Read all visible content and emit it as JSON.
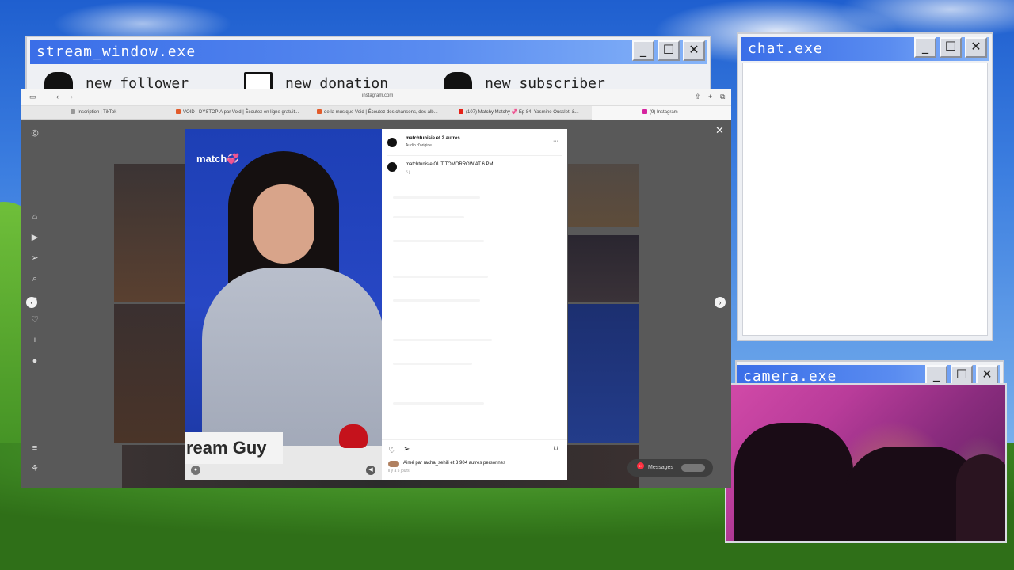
{
  "stream_window": {
    "title": "stream_window.exe",
    "alerts": [
      {
        "label": "new follower"
      },
      {
        "label": "new donation"
      },
      {
        "label": "new subscriber"
      }
    ]
  },
  "chat_window": {
    "title": "chat.exe"
  },
  "camera_window": {
    "title": "camera.exe"
  },
  "window_buttons": {
    "minimize": "_",
    "maximize": "☐",
    "close": "✕"
  },
  "browser": {
    "url": "instagram.com",
    "tabs": [
      {
        "label": "Inscription | TikTok"
      },
      {
        "label": "VOID - DYSTOPIA par Void | Écoutez en ligne gratuit..."
      },
      {
        "label": "de la musique Void | Écoutez des chansons, des alb..."
      },
      {
        "label": "(107) Matchy Matchy 💞 Ep 84: Yasmine Oussleti &..."
      },
      {
        "label": "(9) Instagram"
      }
    ]
  },
  "instagram": {
    "post": {
      "author_line": "matchtunisie et 2 autres",
      "audio": "Audio d'origine",
      "caption_user": "matchtunisie",
      "caption_text": "OUT TOMORROW AT 6 PM",
      "caption_age": "5 j",
      "liked_by": "Aimé par racha_sehili et 3 904 autres personnes",
      "posted_ago": "il y a 5 jours",
      "more_icon": "···"
    },
    "video": {
      "logo": "match💞",
      "lower_third": "ream Guy"
    },
    "messages": {
      "label": "Messages",
      "badge": "9+"
    },
    "close_glyph": "✕",
    "nav_prev": "‹",
    "nav_next": "›"
  },
  "colors": {
    "title_bar": "#3a6ee8",
    "instagram_dim": "#595959",
    "cam_magenta": "#d24aa8"
  }
}
